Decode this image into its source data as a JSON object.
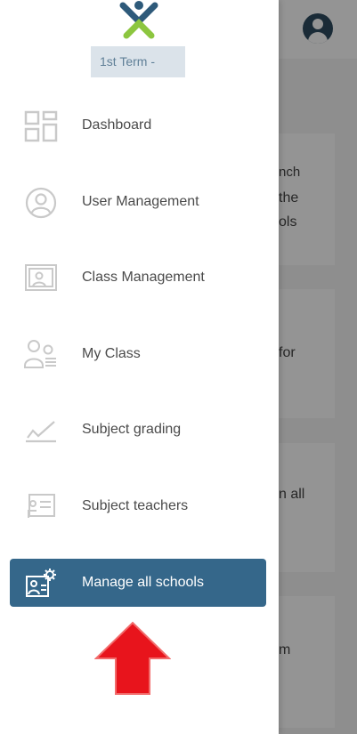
{
  "term": {
    "label": "1st Term -"
  },
  "nav": {
    "items": [
      {
        "label": "Dashboard",
        "icon": "dashboard-icon"
      },
      {
        "label": "User Management",
        "icon": "user-circle-icon"
      },
      {
        "label": "Class Management",
        "icon": "classroom-icon"
      },
      {
        "label": "My Class",
        "icon": "students-icon"
      },
      {
        "label": "Subject grading",
        "icon": "grading-check-icon"
      },
      {
        "label": "Subject teachers",
        "icon": "teacher-board-icon"
      },
      {
        "label": "Manage all schools",
        "icon": "school-settings-icon",
        "active": true
      }
    ]
  },
  "background": {
    "texts": [
      "nch",
      "the",
      "ols",
      "for",
      "n all",
      "m"
    ]
  },
  "colors": {
    "active_bg": "#35678a",
    "term_bg": "#dbe3ea",
    "arrow": "#e8141c",
    "logo_green": "#8cc63f",
    "logo_blue": "#2e5a7a"
  }
}
